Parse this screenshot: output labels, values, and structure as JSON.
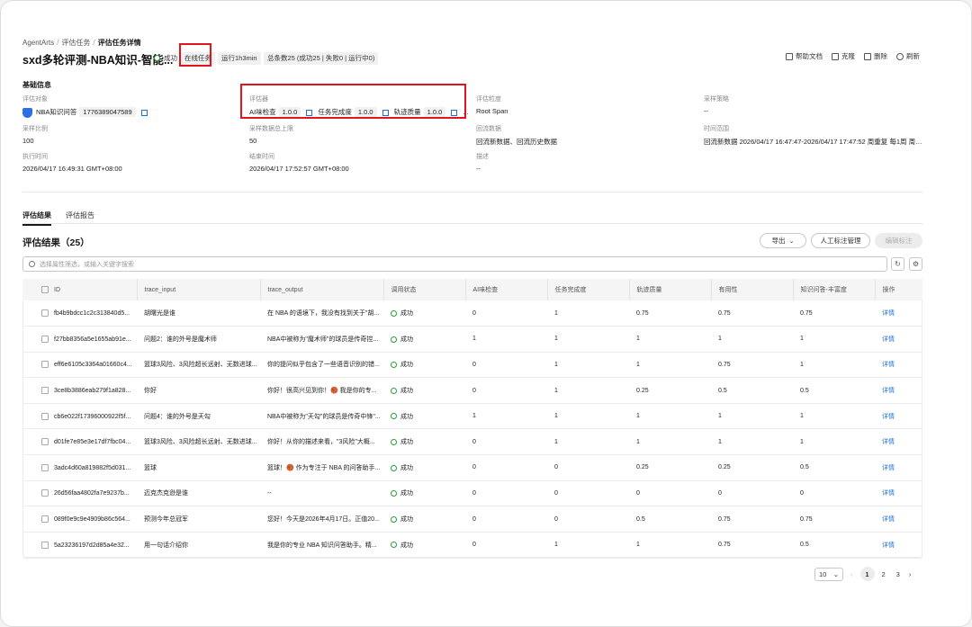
{
  "breadcrumb": {
    "root": "AgentArts",
    "mid": "评估任务",
    "current": "评估任务详情"
  },
  "title": "sxd多轮评测-NBA知识-智能...",
  "status": "成功",
  "tags": {
    "online": "在线任务",
    "runtime": "运行1h3min",
    "total": "总条数25 (成功25 | 失败0 | 运行中0)"
  },
  "actions": {
    "help": "帮助文档",
    "clone": "克隆",
    "delete": "删除",
    "refresh": "刷新"
  },
  "basic_info": {
    "title": "基础信息",
    "eval_object": {
      "label": "评估对象",
      "name": "NBA知识问答",
      "id": "17763890475​89"
    },
    "evaluator": {
      "label": "评估器",
      "items": [
        {
          "name": "AI味检查",
          "ver": "1.0.0"
        },
        {
          "name": "任务完成度",
          "ver": "1.0.0"
        },
        {
          "name": "轨迹质量",
          "ver": "1.0.0"
        }
      ],
      "more": "..."
    },
    "granularity": {
      "label": "评估粒度",
      "value": "Root Span"
    },
    "strategy": {
      "label": "采样策略",
      "value": "--"
    },
    "ratio": {
      "label": "采样比例",
      "value": "100"
    },
    "max_count": {
      "label": "采样数据总上限",
      "value": "50"
    },
    "backflow": {
      "label": "回流数据",
      "value": "回流新数据、回流历史数据"
    },
    "time_range": {
      "label": "时间范围",
      "value": "回流新数据 2026/04/17 16:47:47-2026/04/17 17:47:52 周重复 每1周 周五 5 回..."
    },
    "exec_time": {
      "label": "执行时间",
      "value": "2026/04/17 16:49:31 GMT+08:00"
    },
    "end_time": {
      "label": "结束时间",
      "value": "2026/04/17 17:52:57 GMT+08:00"
    },
    "desc": {
      "label": "描述",
      "value": "--"
    }
  },
  "tabs": {
    "results": "评估结果",
    "report": "评估报告"
  },
  "results": {
    "title": "评估结果（25）",
    "export": "导出",
    "manual": "人工标注管理",
    "edit": "编辑标注",
    "search_placeholder": "选择属性筛选，或输入关键字搜索",
    "columns": [
      "ID",
      "trace_input",
      "trace_output",
      "调用状态",
      "AI味检查",
      "任务完成度",
      "轨迹质量",
      "有用性",
      "知识问答-丰富度",
      "操作"
    ],
    "rows": [
      {
        "id": "fb4b9bdcc1c2c313840d5...",
        "input": "胡曙光是谁",
        "output": "在 NBA 的语境下，我没有找到关于\"胡...",
        "status": "成功",
        "ai": "0",
        "task": "1",
        "traj": "0.75",
        "useful": "0.75",
        "rich": "0.75",
        "op": "详情"
      },
      {
        "id": "f27bb8356a5e1655ab91e...",
        "input": "问题2：谁的外号是魔术师",
        "output": "NBA中被称为\"魔术师\"的球员是传奇控...",
        "status": "成功",
        "ai": "1",
        "task": "1",
        "traj": "1",
        "useful": "1",
        "rich": "1",
        "op": "详情"
      },
      {
        "id": "eff6e6105c3364a01660c4...",
        "input": "篮球3风险、3风险超长远射、无数进球...",
        "output": "你的提问似乎包含了一些语音识别的错...",
        "status": "成功",
        "ai": "0",
        "task": "1",
        "traj": "1",
        "useful": "0.75",
        "rich": "1",
        "op": "详情"
      },
      {
        "id": "3ce8b3886eab279f1a828...",
        "input": "你好",
        "output": "你好！很高兴见到你！🏀 我是你的专...",
        "status": "成功",
        "ai": "0",
        "task": "1",
        "traj": "0.25",
        "useful": "0.5",
        "rich": "0.5",
        "op": "详情"
      },
      {
        "id": "cb6e022f17396000922f5f...",
        "input": "问题4：谁的外号是天勾",
        "output": "NBA中被称为\"天勾\"的球员是传奇中锋\"...",
        "status": "成功",
        "ai": "1",
        "task": "1",
        "traj": "1",
        "useful": "1",
        "rich": "1",
        "op": "详情"
      },
      {
        "id": "d01fe7e85e3e17df7fbc04...",
        "input": "篮球3风险、3风险超长远射、无数进球...",
        "output": "你好！从你的描述来看，\"3风险\"大概...",
        "status": "成功",
        "ai": "0",
        "task": "1",
        "traj": "1",
        "useful": "1",
        "rich": "1",
        "op": "详情"
      },
      {
        "id": "3adc4d60a819882f5d031...",
        "input": "篮球",
        "output": "篮球！🏀 作为专注于 NBA 的问答助手...",
        "status": "成功",
        "ai": "0",
        "task": "0",
        "traj": "0.25",
        "useful": "0.25",
        "rich": "0.5",
        "op": "详情"
      },
      {
        "id": "26d56faa4802fa7e9237b...",
        "input": "迈克杰克逊是谁",
        "output": "--",
        "status": "成功",
        "ai": "0",
        "task": "0",
        "traj": "0",
        "useful": "0",
        "rich": "0",
        "op": "详情"
      },
      {
        "id": "089f0e9c9e4909b86c564...",
        "input": "预测今年总冠军",
        "output": "您好！今天是2026年4月17日。正值20...",
        "status": "成功",
        "ai": "0",
        "task": "0",
        "traj": "0.5",
        "useful": "0.75",
        "rich": "0.75",
        "op": "详情"
      },
      {
        "id": "5a23236197d2d85a4e32...",
        "input": "用一句话介绍你",
        "output": "我是你的专业 NBA 知识问答助手。精...",
        "status": "成功",
        "ai": "0",
        "task": "1",
        "traj": "1",
        "useful": "0.75",
        "rich": "0.5",
        "op": "详情"
      }
    ]
  },
  "pagination": {
    "page_size": "10",
    "pages": [
      "1",
      "2",
      "3"
    ],
    "current": "1"
  },
  "colors": {
    "success": "#2e9b3a",
    "link": "#1f6fd6",
    "highlight": "#e3141c"
  }
}
